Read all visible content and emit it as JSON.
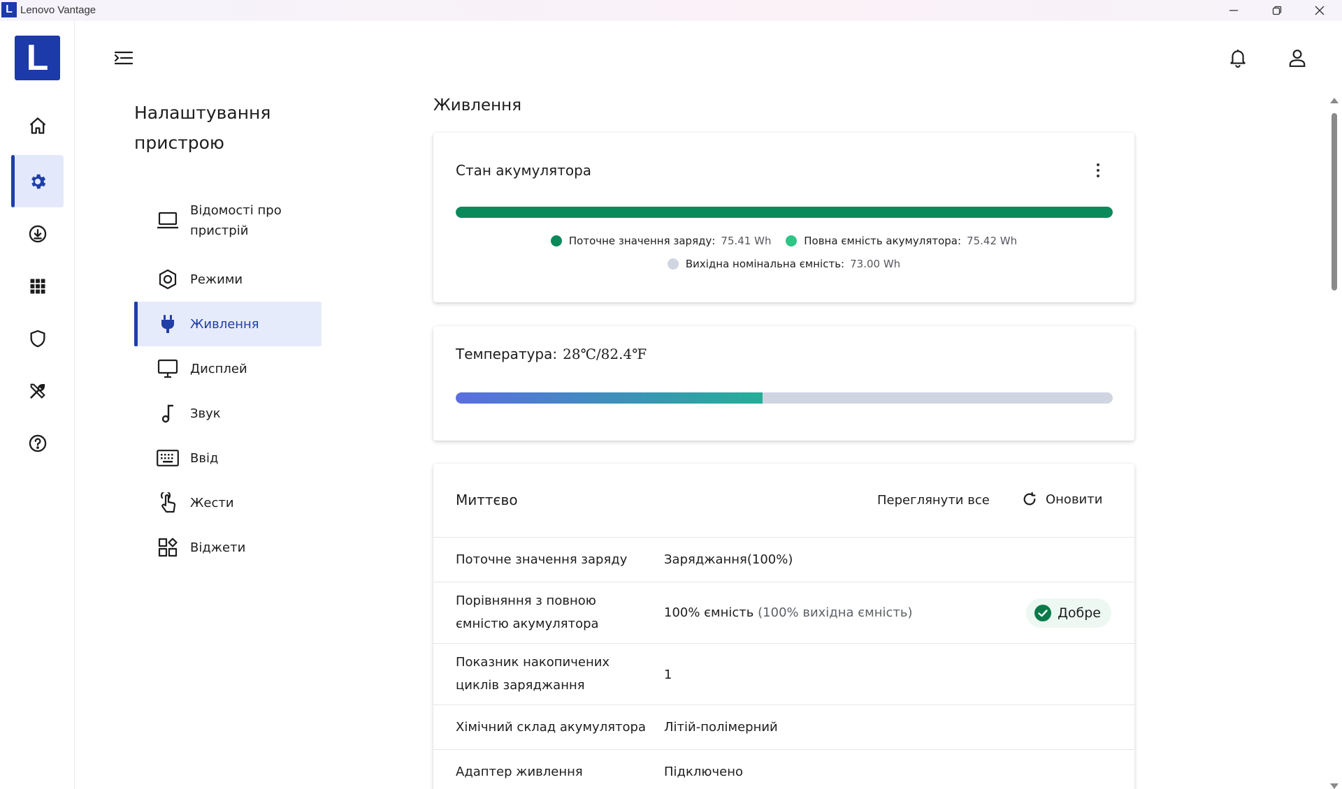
{
  "window": {
    "title": "Lenovo Vantage",
    "app_icon_letter": "L"
  },
  "rail": {
    "logo_letter": "L",
    "items": [
      {
        "name": "home-icon"
      },
      {
        "name": "gear-icon",
        "active": true
      },
      {
        "name": "download-icon"
      },
      {
        "name": "apps-grid-icon"
      },
      {
        "name": "shield-icon"
      },
      {
        "name": "tools-icon"
      },
      {
        "name": "help-icon"
      }
    ]
  },
  "section": {
    "title": "Налаштування пристрою",
    "nav": [
      {
        "label": "Відомості про пристрій",
        "icon": "laptop-icon"
      },
      {
        "label": "Режими",
        "icon": "hexagon-icon"
      },
      {
        "label": "Живлення",
        "icon": "plug-icon",
        "active": true
      },
      {
        "label": "Дисплей",
        "icon": "monitor-icon"
      },
      {
        "label": "Звук",
        "icon": "music-note-icon"
      },
      {
        "label": "Ввід",
        "icon": "keyboard-icon"
      },
      {
        "label": "Жести",
        "icon": "touch-icon"
      },
      {
        "label": "Віджети",
        "icon": "widgets-icon"
      }
    ]
  },
  "main": {
    "title": "Живлення",
    "battery_card": {
      "title": "Стан акумулятора",
      "charge_fraction": 0.9999,
      "legend": [
        {
          "label": "Поточне значення заряду:",
          "value": "75.41 Wh",
          "color": "#0a8a5a"
        },
        {
          "label": "Повна ємність акумулятора:",
          "value": "75.42 Wh",
          "color": "#2ec486"
        },
        {
          "label": "Вихідна номінальна ємність:",
          "value": "73.00 Wh",
          "color": "#cfd6e2"
        }
      ]
    },
    "temperature_card": {
      "label": "Температура:",
      "value": "28℃/82.4℉",
      "level_fraction": 0.467
    },
    "instant_card": {
      "title": "Миттєво",
      "view_all": "Переглянути все",
      "refresh": "Оновити",
      "rows": [
        {
          "label": "Поточне значення заряду",
          "value": "Заряджання(100%)"
        },
        {
          "label": "Порівняння з повною ємністю акумулятора",
          "value": "100% ємність",
          "sub": "(100% вихідна ємність)",
          "badge": "Добре"
        },
        {
          "label": "Показник накопичених циклів заряджання",
          "value": "1"
        },
        {
          "label": "Хімічний склад акумулятора",
          "value": "Літій-полімерний"
        },
        {
          "label": "Адаптер живлення",
          "value": "Підключено"
        }
      ]
    }
  },
  "colors": {
    "accent": "#1f3ea8",
    "battery_bar": "#0a8a5a",
    "temp_gradient": [
      "#5b6ee1",
      "#1aba8a",
      "#8cb83a"
    ],
    "track": "#cfd6e2",
    "good_check": "#0a7a4a"
  }
}
